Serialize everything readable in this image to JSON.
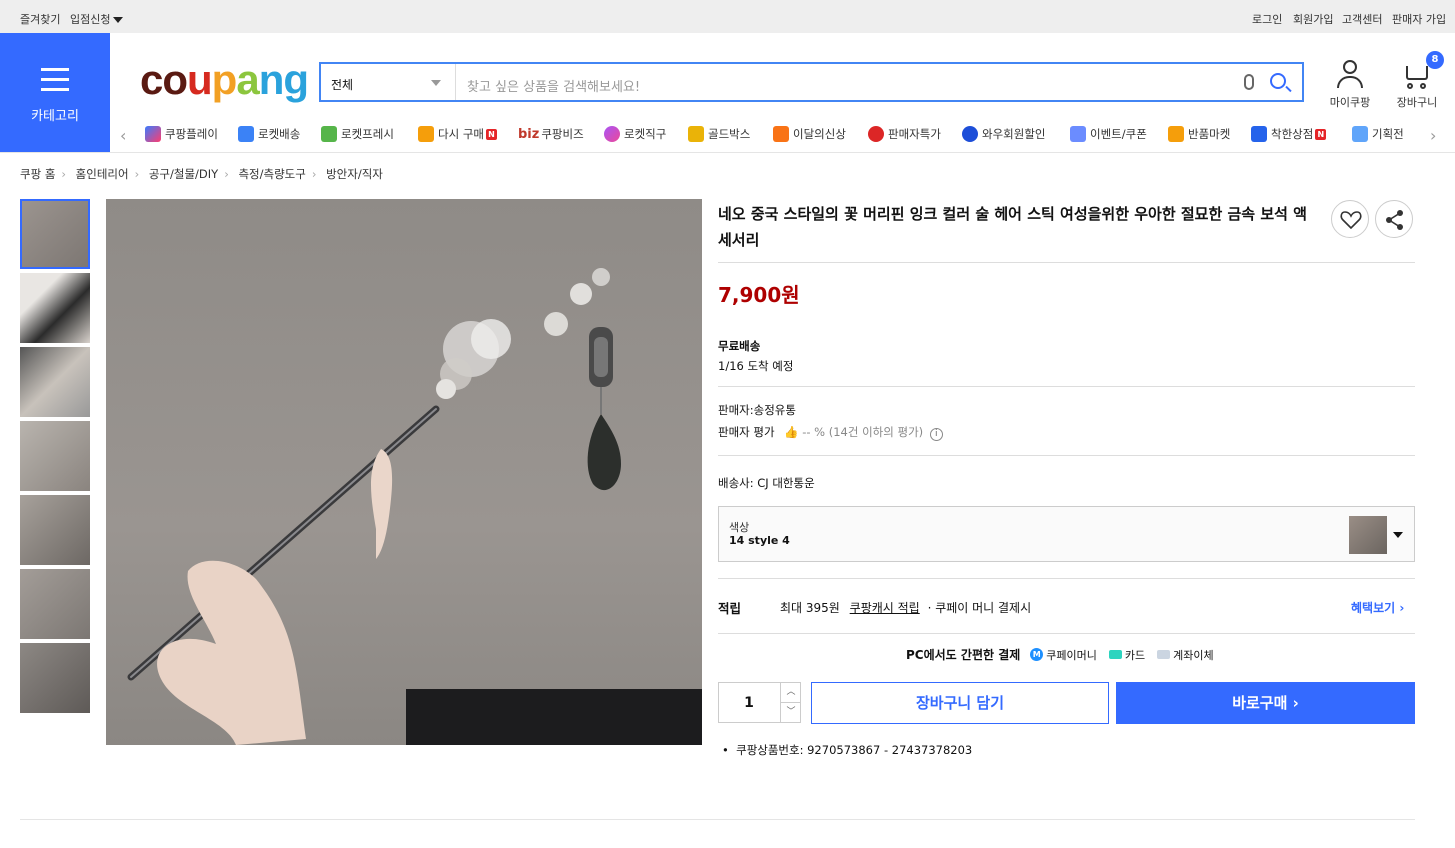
{
  "topbar": {
    "left": [
      "즐겨찾기",
      "입점신청"
    ],
    "right": [
      "로그인",
      "회원가입",
      "고객센터",
      "판매자 가입"
    ]
  },
  "header": {
    "category_label": "카테고리",
    "logo": "coupang",
    "search_category": "전체",
    "search_placeholder": "찾고 싶은 상품을 검색해보세요!",
    "mycoupang": "마이쿠팡",
    "cart": "장바구니",
    "cart_count": "8"
  },
  "nav": {
    "items": [
      "쿠팡플레이",
      "로켓배송",
      "로켓프레시",
      "다시 구매",
      "쿠팡비즈",
      "로켓직구",
      "골드박스",
      "이달의신상",
      "판매자특가",
      "와우회원할인",
      "이벤트/쿠폰",
      "반품마켓",
      "착한상점",
      "기획전"
    ],
    "biz_prefix": "biz",
    "new_badge": "N"
  },
  "breadcrumb": [
    "쿠팡 홈",
    "홈인테리어",
    "공구/철물/DIY",
    "측정/측량도구",
    "방안자/직자"
  ],
  "product": {
    "title": "네오 중국 스타일의 꽃 머리핀 잉크 컬러 술 헤어 스틱 여성을위한 우아한 절묘한 금속 보석 액세서리",
    "price": "7,900원",
    "shipping_label": "무료배송",
    "arrival": "1/16 도착 예정",
    "seller": "판매자:송정유통",
    "seller_rating_label": "판매자 평가",
    "seller_rating_value": "-- % (14건 이하의 평가)",
    "carrier": "배송사:  CJ 대한통운",
    "option_label": "색상",
    "option_value": "14 style 4",
    "reward_label": "적립",
    "reward_text1": "최대 395원",
    "reward_link": "쿠팡캐시 적립",
    "reward_text2": "· 쿠페이 머니 결제시",
    "benefit_link": "혜택보기",
    "pay_title": "PC에서도 간편한 결제",
    "pay_methods": [
      "쿠페이머니",
      "카드",
      "계좌이체"
    ],
    "pay_m_letter": "M",
    "quantity": "1",
    "add_to_cart": "장바구니 담기",
    "buy_now": "바로구매",
    "product_no": "쿠팡상품번호: 9270573867 - 27437378203"
  },
  "colors": {
    "brand_blue": "#346aff",
    "price_red": "#ae0000",
    "badge_red": "#e52528"
  }
}
